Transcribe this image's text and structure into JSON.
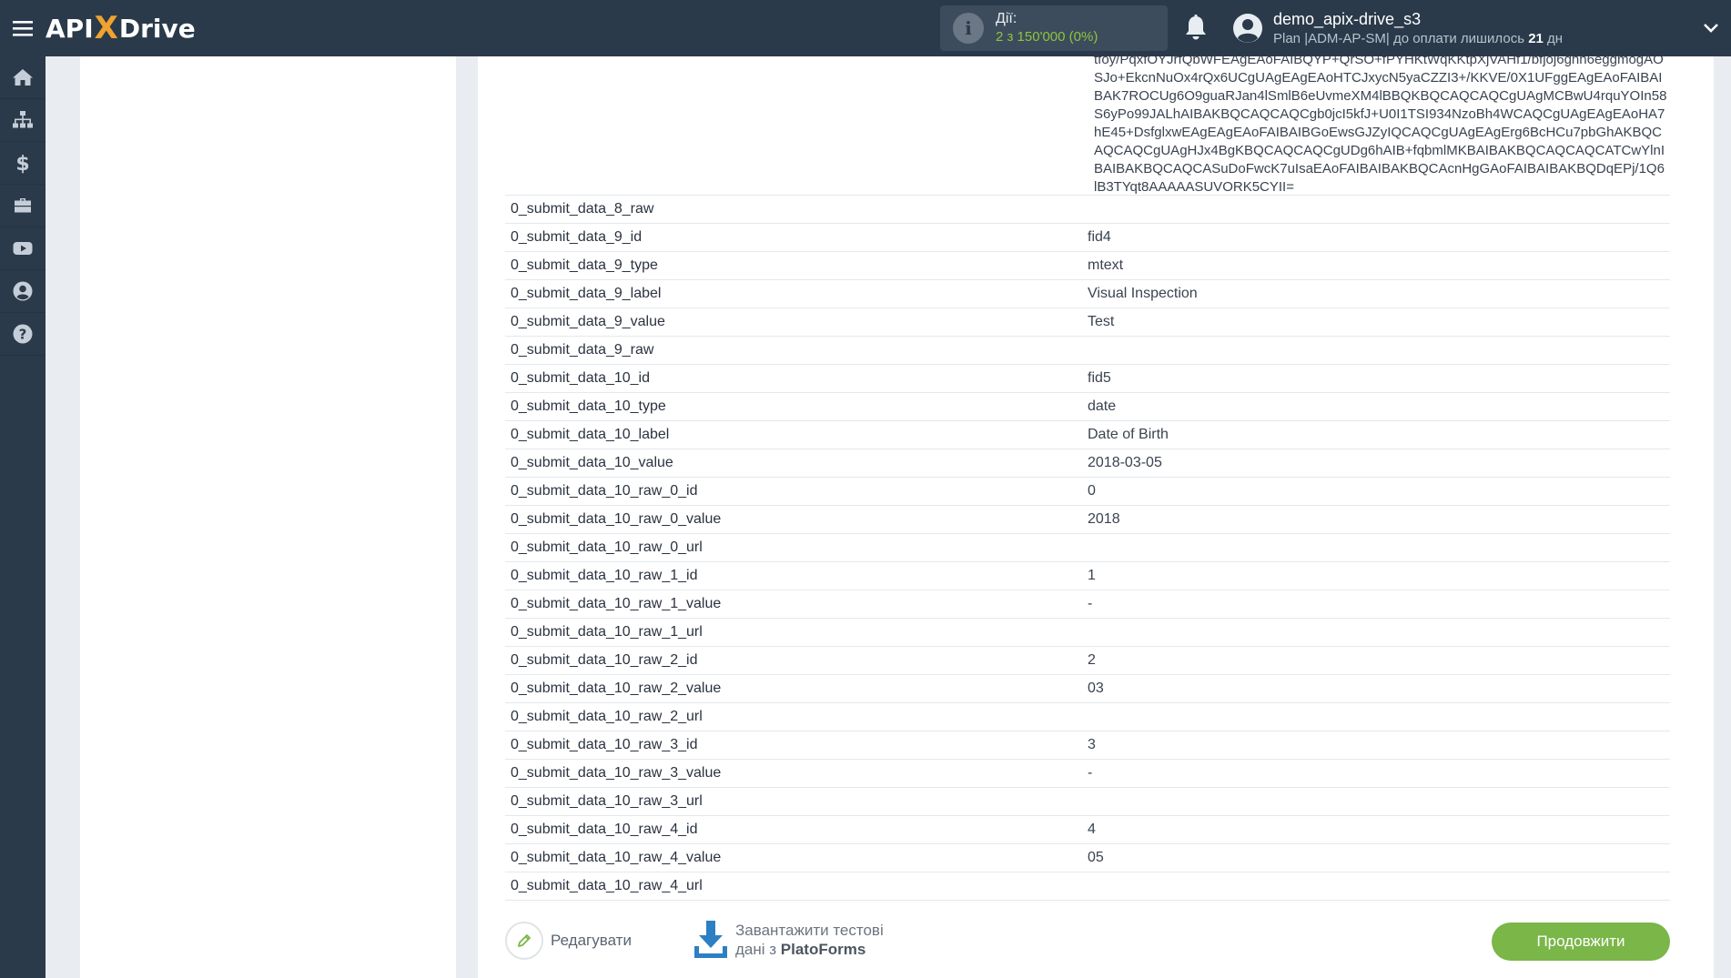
{
  "brand": {
    "logo_part1": "APIX",
    "logo_x": "X",
    "logo_part2": "Drive",
    "display_left": "API",
    "display_right": "Drive",
    "accent_color": "#f0a32e"
  },
  "header": {
    "actions_label": "Дії:",
    "actions_value": "2 з 150'000 (0%)",
    "username": "demo_apix-drive_s3",
    "plan_text": "Plan |ADM-AP-SM| до оплати лишилось ",
    "plan_days": "21",
    "plan_days_unit": " дн"
  },
  "sidebar": {
    "items": [
      {
        "icon": "home-icon"
      },
      {
        "icon": "sitemap-icon"
      },
      {
        "icon": "dollar-icon"
      },
      {
        "icon": "briefcase-icon"
      },
      {
        "icon": "youtube-icon"
      },
      {
        "icon": "user-circle-icon"
      },
      {
        "icon": "question-icon"
      }
    ]
  },
  "base64_text": "tfoy/PqxfOYJrfQbWFEAgEAoFAIBQYP+QrSO+fPYHKtWqKKtpXjVAHf1/bfjoj6ghh6eggmogAOSJo+EkcnNuOx4rQx6UCgUAgEAgEAoHTCJxycN5yaCZZI3+/KKVE/0X1UFggEAgEAoFAIBAIBAK7ROCUg6O9guaRJan4lSmlB6eUvmeXM4lBBQKBQCAQCAQCgUAgMCBwU4rquYOIn58S6yPo99JALhAIBAKBQCAQCAQCgb0jcI5kfJ+U0I1TSI934NzoBh4WCAQCgUAgEAgEAoHA7hE45+DsfglxwEAgEAgEAoFAIBAIBGoEwsGJZyIQCAQCgUAgEAgErg6BcHCu7pbGhAKBQCAQCAQCgUAgHJx4BgKBQCAQCAQCgUDg6hAIB+fqbmlMKBAIBAKBQCAQCAQCATCwYlnIBAIBAKBQCAQCASuDoFwcK7uIsaEAoFAIBAIBAKBQCAcnHgGAoFAIBAIBAKBQDqEPj/1Q6lB3TYqt8AAAAASUVORK5CYII=",
  "rows": [
    {
      "key": "0_submit_data_8_raw",
      "value": ""
    },
    {
      "key": "0_submit_data_9_id",
      "value": "fid4"
    },
    {
      "key": "0_submit_data_9_type",
      "value": "mtext"
    },
    {
      "key": "0_submit_data_9_label",
      "value": "Visual Inspection"
    },
    {
      "key": "0_submit_data_9_value",
      "value": "Test"
    },
    {
      "key": "0_submit_data_9_raw",
      "value": ""
    },
    {
      "key": "0_submit_data_10_id",
      "value": "fid5"
    },
    {
      "key": "0_submit_data_10_type",
      "value": "date"
    },
    {
      "key": "0_submit_data_10_label",
      "value": "Date of Birth"
    },
    {
      "key": "0_submit_data_10_value",
      "value": "2018-03-05"
    },
    {
      "key": "0_submit_data_10_raw_0_id",
      "value": "0"
    },
    {
      "key": "0_submit_data_10_raw_0_value",
      "value": "2018"
    },
    {
      "key": "0_submit_data_10_raw_0_url",
      "value": ""
    },
    {
      "key": "0_submit_data_10_raw_1_id",
      "value": "1"
    },
    {
      "key": "0_submit_data_10_raw_1_value",
      "value": "-"
    },
    {
      "key": "0_submit_data_10_raw_1_url",
      "value": ""
    },
    {
      "key": "0_submit_data_10_raw_2_id",
      "value": "2"
    },
    {
      "key": "0_submit_data_10_raw_2_value",
      "value": "03"
    },
    {
      "key": "0_submit_data_10_raw_2_url",
      "value": ""
    },
    {
      "key": "0_submit_data_10_raw_3_id",
      "value": "3"
    },
    {
      "key": "0_submit_data_10_raw_3_value",
      "value": "-"
    },
    {
      "key": "0_submit_data_10_raw_3_url",
      "value": ""
    },
    {
      "key": "0_submit_data_10_raw_4_id",
      "value": "4"
    },
    {
      "key": "0_submit_data_10_raw_4_value",
      "value": "05"
    },
    {
      "key": "0_submit_data_10_raw_4_url",
      "value": ""
    }
  ],
  "footer": {
    "edit_label": "Редагувати",
    "download_line1": "Завантажити тестові",
    "download_line2_prefix": "дані з ",
    "download_line2_service": "PlatoForms",
    "continue_label": "Продовжити",
    "continue_color": "#7ab648"
  }
}
